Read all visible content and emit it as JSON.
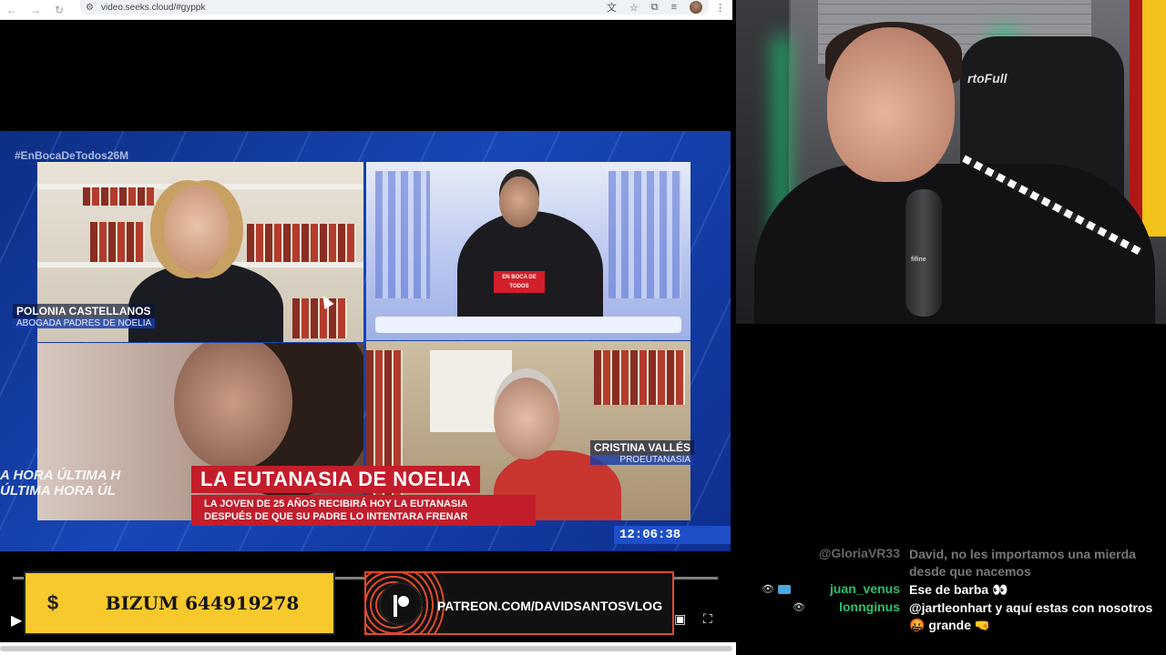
{
  "browser": {
    "url": "video.seeks.cloud/#gyppk",
    "back_icon": "←",
    "forward_icon": "→",
    "reload_icon": "↻",
    "tune_icon": "⚙",
    "translate_icon": "文",
    "bookmark_icon": "☆",
    "extensions_icon": "⧉",
    "media_icon": "≡",
    "menu_icon": "⋮"
  },
  "broadcast": {
    "hashtag": "#EnBocaDeTodos26M",
    "guest1": {
      "name": "POLONIA CASTELLANOS",
      "role": "ABOGADA PADRES DE NOELIA"
    },
    "guest2": {
      "name": "CRISTINA VALLÉS",
      "role": "PROEUTANASIA"
    },
    "hoodie_text": "EN BOCA DE TODOS",
    "headline": "LA EUTANASIA DE NOELIA",
    "subline1": "LA JOVEN DE 25 AÑOS RECIBIRÁ HOY LA EUTANASIA",
    "subline2": "DESPUÉS DE QUE SU PADRE LO INTENTARA FRENAR",
    "ultima1": "A HORA   ÚLTIMA H",
    "ultima2": "ÚLTIMA HORA   ÚL",
    "clock": "12:06:38",
    "progress": 0.0
  },
  "player": {
    "play_icon": "▶",
    "miniplayer_icon": "▣",
    "fullscreen_icon": "⛶"
  },
  "overlays": {
    "bizum_symbol": "$",
    "bizum_text": "BIZUM 644919278",
    "patreon_text": "PATREON.COM/DAVIDSANTOSVLOG"
  },
  "webcam": {
    "chair_brand": "rtoFull",
    "mic_label": "fifine"
  },
  "chat": {
    "messages": [
      {
        "user": "@GloriaVR33",
        "text": "David, no les importamos una mierda desde que nacemos",
        "faded": true,
        "user_color": "#666666"
      },
      {
        "user": "juan_venus",
        "text": "Ese de barba 👀",
        "faded": false,
        "user_color": "#27c26b"
      },
      {
        "user": "lonnginus",
        "text": "@jartleonhart y aquí estas con nosotros 🤬 grande 🤜",
        "faded": false,
        "user_color": "#27c26b"
      }
    ]
  }
}
